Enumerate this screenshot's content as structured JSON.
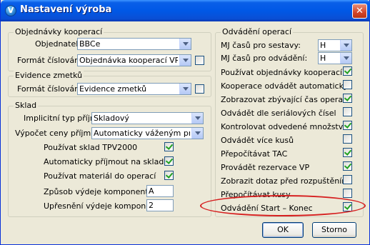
{
  "window": {
    "title": "Nastavení výroba",
    "icon": "app-v-icon",
    "icon_letter": "V",
    "close_symbol": "✕"
  },
  "objednavky": {
    "legend": "Objednávky kooperací",
    "objednatel_label": "Objednatel:",
    "objednatel_value": "BBCe",
    "format_label": "Formát číslování:",
    "format_value": "Objednávka kooperací VP"
  },
  "zmetky": {
    "legend": "Evidence zmetků",
    "format_label": "Formát číslování:",
    "format_value": "Evidence zmetků"
  },
  "sklad": {
    "legend": "Sklad",
    "implicitni_label": "Implicitní typ příjmu:",
    "implicitni_value": "Skladový",
    "vypocet_label": "Výpočet ceny příjmu:",
    "vypocet_value": "Automaticky váženým průmě",
    "checks": [
      {
        "label": "Používat sklad TPV2000",
        "checked": true
      },
      {
        "label": "Automaticky příjmout na sklad",
        "checked": true
      },
      {
        "label": "Používat materiál do operací",
        "checked": true
      }
    ],
    "zpusob_label": "Způsob výdeje komponent:",
    "zpusob_value": "A",
    "upresneni_label": "Upřesnění výdeje komponent:",
    "upresneni_value": "2"
  },
  "odvadeni": {
    "legend": "Odvádění operací",
    "mj_sestavy_label": "MJ časů pro sestavy:",
    "mj_sestavy_value": "H",
    "mj_odvadeni_label": "MJ časů pro odvádění:",
    "mj_odvadeni_value": "H",
    "checks": [
      {
        "label": "Používat objednávky kooperací",
        "checked": true
      },
      {
        "label": "Kooperace odvádět automaticky",
        "checked": false
      },
      {
        "label": "Zobrazovat zbývající čas operace",
        "checked": true
      },
      {
        "label": "Odvádět dle seriálových čísel",
        "checked": false
      },
      {
        "label": "Kontrolovat odvedené množství",
        "checked": true
      },
      {
        "label": "Odvádět více kusů",
        "checked": false
      },
      {
        "label": "Přepočítávat TAC",
        "checked": true
      },
      {
        "label": "Provádět rezervace VP",
        "checked": true
      },
      {
        "label": "Zobrazit dotaz před rozpuštěním",
        "checked": false
      },
      {
        "label": "Přepočítávat kusy",
        "checked": false
      },
      {
        "label": "Odvádění Start – Konec",
        "checked": true
      }
    ]
  },
  "buttons": {
    "ok": "OK",
    "cancel": "Storno"
  }
}
